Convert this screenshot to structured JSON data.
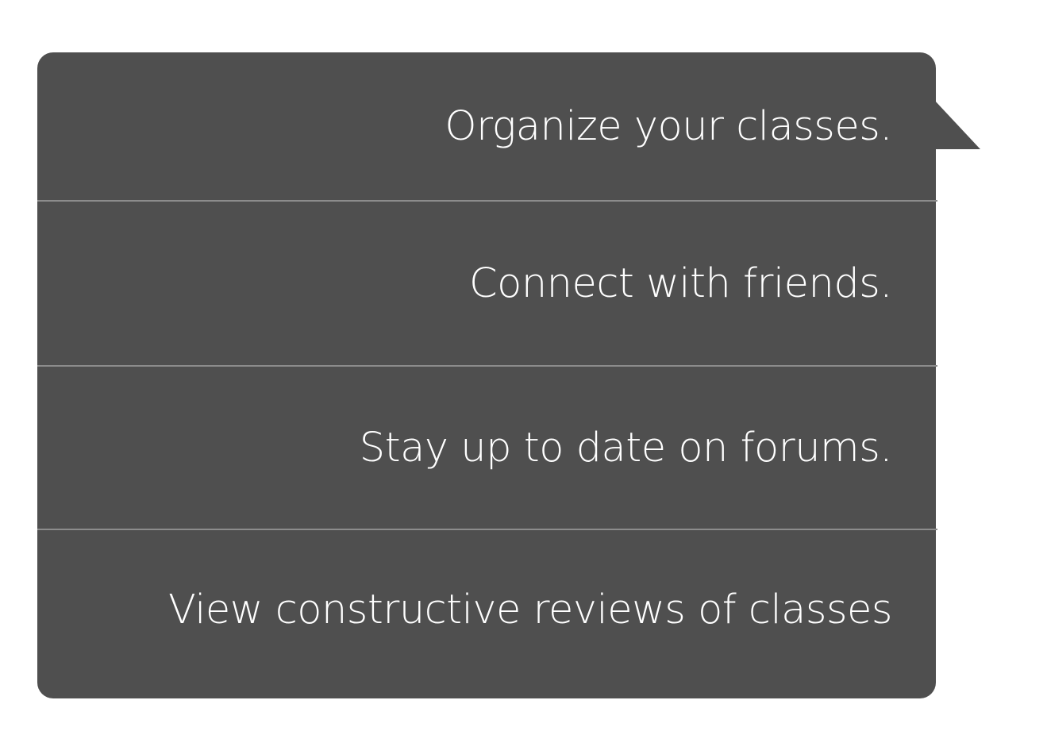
{
  "menu": {
    "items": [
      {
        "label": "Organize your classes."
      },
      {
        "label": "Connect with friends."
      },
      {
        "label": "Stay up to date on forums."
      },
      {
        "label": "View constructive reviews of classes"
      }
    ]
  },
  "colors": {
    "panel_background": "#4f4f4f",
    "divider": "#8c8c8c",
    "text": "#ffffff",
    "page_background": "#ffffff"
  }
}
